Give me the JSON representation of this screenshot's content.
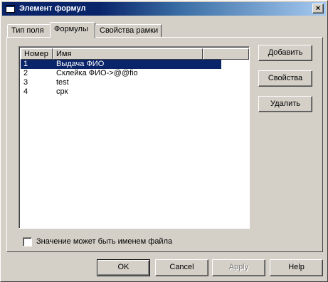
{
  "window": {
    "title": "Элемент формул",
    "close_glyph": "×"
  },
  "tabs": [
    {
      "label": "Тип поля",
      "active": false
    },
    {
      "label": "Формулы",
      "active": true
    },
    {
      "label": "Свойства рамки",
      "active": false
    }
  ],
  "list": {
    "columns": [
      "Номер",
      "Имя"
    ],
    "rows": [
      {
        "num": "1",
        "name": "Выдача ФИО",
        "selected": true
      },
      {
        "num": "2",
        "name": "Склейка ФИО->@@fio",
        "selected": false
      },
      {
        "num": "3",
        "name": "test",
        "selected": false
      },
      {
        "num": "4",
        "name": "срк",
        "selected": false
      }
    ]
  },
  "side_buttons": {
    "add": "Добавить",
    "properties": "Свойства",
    "delete": "Удалить"
  },
  "checkbox": {
    "label": "Значение может быть именем файла",
    "checked": false
  },
  "bottom_buttons": {
    "ok": "OK",
    "cancel": "Cancel",
    "apply": "Apply",
    "help": "Help"
  },
  "icons": {
    "window_icon": "window-icon",
    "close": "close-icon"
  },
  "colors": {
    "titlebar": "#0a246a",
    "selection": "#0a246a",
    "face": "#d4d0c8"
  }
}
